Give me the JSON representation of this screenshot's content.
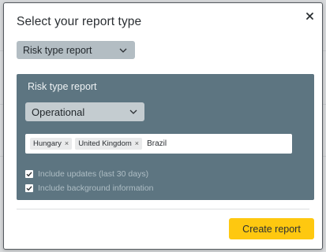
{
  "modal": {
    "title": "Select your report type",
    "close_icon": "close-icon"
  },
  "report_type_select": {
    "value": "Risk type report",
    "icon": "chevron-down-icon"
  },
  "panel": {
    "title": "Risk type report",
    "risk_select": {
      "value": "Operational",
      "icon": "chevron-down-icon"
    },
    "countries": {
      "tags": [
        {
          "label": "Hungary",
          "remove_icon": "×"
        },
        {
          "label": "United Kingdom",
          "remove_icon": "×"
        }
      ],
      "typed_value": "Brazil"
    },
    "options": [
      {
        "label": "Include updates (last 30 days)",
        "checked": true
      },
      {
        "label": "Include background information",
        "checked": true
      }
    ]
  },
  "footer": {
    "create_button": "Create report"
  },
  "colors": {
    "accent": "#fec810",
    "panel": "#5d7581",
    "select_bg": "#b3bdc3"
  }
}
